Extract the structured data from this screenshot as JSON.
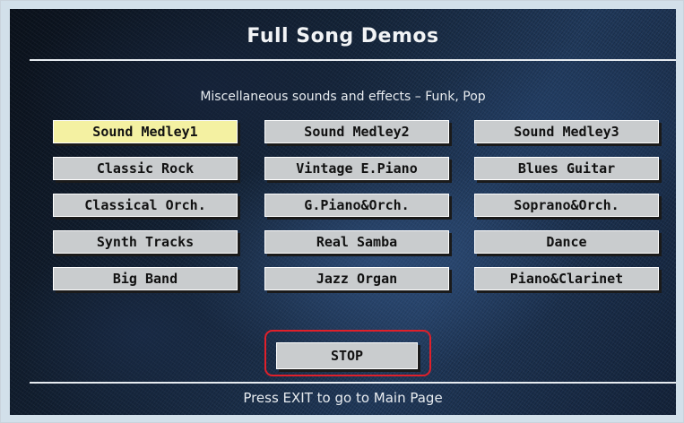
{
  "page": {
    "title": "Full Song Demos",
    "subtitle": "Miscellaneous sounds and effects – Funk, Pop",
    "footer": "Press EXIT to go to Main Page"
  },
  "songs": [
    {
      "label": "Sound Medley1",
      "selected": true
    },
    {
      "label": "Sound Medley2",
      "selected": false
    },
    {
      "label": "Sound Medley3",
      "selected": false
    },
    {
      "label": "Classic Rock",
      "selected": false
    },
    {
      "label": "Vintage E.Piano",
      "selected": false
    },
    {
      "label": "Blues Guitar",
      "selected": false
    },
    {
      "label": "Classical Orch.",
      "selected": false
    },
    {
      "label": "G.Piano&Orch.",
      "selected": false
    },
    {
      "label": "Soprano&Orch.",
      "selected": false
    },
    {
      "label": "Synth Tracks",
      "selected": false
    },
    {
      "label": "Real Samba",
      "selected": false
    },
    {
      "label": "Dance",
      "selected": false
    },
    {
      "label": "Big Band",
      "selected": false
    },
    {
      "label": "Jazz Organ",
      "selected": false
    },
    {
      "label": "Piano&Clarinet",
      "selected": false
    }
  ],
  "controls": {
    "stop_label": "STOP"
  },
  "colors": {
    "selected_button": "#f4f1a2",
    "button": "#c9ccce",
    "highlight_ring": "#e0202a"
  }
}
